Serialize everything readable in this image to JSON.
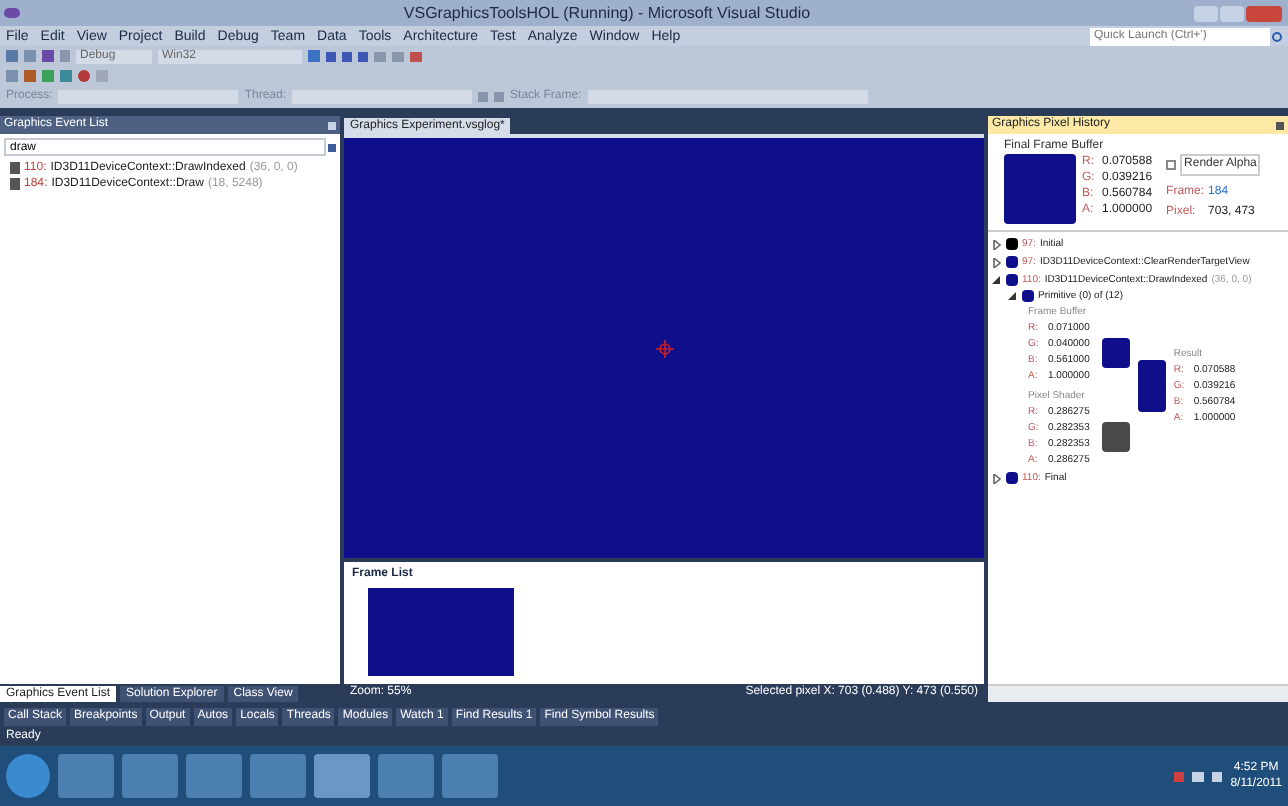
{
  "window": {
    "title": "VSGraphicsToolsHOL (Running) - Microsoft Visual Studio"
  },
  "menu": [
    "File",
    "Edit",
    "View",
    "Project",
    "Build",
    "Debug",
    "Team",
    "Data",
    "Tools",
    "Architecture",
    "Test",
    "Analyze",
    "Window",
    "Help"
  ],
  "quick_launch": {
    "placeholder": "Quick Launch (Ctrl+')"
  },
  "toolbar": {
    "configuration": "Debug",
    "platform": "Win32",
    "process_label": "Process:",
    "thread_label": "Thread:",
    "stack_frame_label": "Stack Frame:"
  },
  "event_list": {
    "title": "Graphics Event List",
    "search": {
      "value": "draw"
    },
    "items": [
      {
        "id": "110:",
        "name": "ID3D11DeviceContext::DrawIndexed",
        "args": "(36, 0, 0)"
      },
      {
        "id": "184:",
        "name": "ID3D11DeviceContext::Draw",
        "args": "(18, 5248)"
      }
    ],
    "tabs": [
      {
        "label": "Graphics Event List",
        "selected": true
      },
      {
        "label": "Solution Explorer",
        "selected": false
      },
      {
        "label": "Class View",
        "selected": false
      }
    ]
  },
  "document": {
    "tab": "Graphics Experiment.vsglog*",
    "frame_list_title": "Frame List",
    "zoom": "Zoom: 55%",
    "selected_pixel": "Selected pixel X: 703 (0.488) Y: 473 (0.550)"
  },
  "pixel_history": {
    "title": "Graphics Pixel History",
    "final_title": "Final Frame Buffer",
    "final_values": [
      {
        "channel": "R:",
        "value": "0.070588"
      },
      {
        "channel": "G:",
        "value": "0.039216"
      },
      {
        "channel": "B:",
        "value": "0.560784"
      },
      {
        "channel": "A:",
        "value": "1.000000"
      }
    ],
    "render_alpha": {
      "label": "Render Alpha",
      "checked": false
    },
    "frame_label": "Frame:",
    "frame": "184",
    "pixel_label": "Pixel:",
    "pixel": "703, 473",
    "events": [
      {
        "id": "97:",
        "name": "Initial",
        "color": "#000000",
        "expanded": false
      },
      {
        "id": "97:",
        "name": "ID3D11DeviceContext::ClearRenderTargetView",
        "color": "#0f0f8c",
        "expanded": false
      },
      {
        "id": "110:",
        "name": "ID3D11DeviceContext::DrawIndexed",
        "args": "(36, 0, 0)",
        "color": "#0f0f8c",
        "expanded": true,
        "primitive": {
          "label": "Primitive (0) of (12)",
          "color": "#0f0f8c",
          "expanded": true,
          "frame_buffer": {
            "title": "Frame Buffer",
            "color": "#0f0f8c",
            "values": [
              {
                "channel": "R:",
                "value": "0.071000"
              },
              {
                "channel": "G:",
                "value": "0.040000"
              },
              {
                "channel": "B:",
                "value": "0.561000"
              },
              {
                "channel": "A:",
                "value": "1.000000"
              }
            ]
          },
          "pixel_shader": {
            "title": "Pixel Shader",
            "color": "#494949",
            "values": [
              {
                "channel": "R:",
                "value": "0.286275"
              },
              {
                "channel": "G:",
                "value": "0.282353"
              },
              {
                "channel": "B:",
                "value": "0.282353"
              },
              {
                "channel": "A:",
                "value": "0.286275"
              }
            ]
          },
          "result": {
            "title": "Result",
            "color": "#0f0f8c",
            "values": [
              {
                "channel": "R:",
                "value": "0.070588"
              },
              {
                "channel": "G:",
                "value": "0.039216"
              },
              {
                "channel": "B:",
                "value": "0.560784"
              },
              {
                "channel": "A:",
                "value": "1.000000"
              }
            ]
          }
        }
      },
      {
        "id": "110:",
        "name": "Final",
        "color": "#0f0f8c",
        "expanded": false
      }
    ]
  },
  "tool_tabs": [
    "Call Stack",
    "Breakpoints",
    "Output",
    "Autos",
    "Locals",
    "Threads",
    "Modules",
    "Watch 1",
    "Find Results 1",
    "Find Symbol Results"
  ],
  "status_bar": "Ready",
  "taskbar": {
    "time": "4:52 PM",
    "date": "8/11/2011"
  }
}
